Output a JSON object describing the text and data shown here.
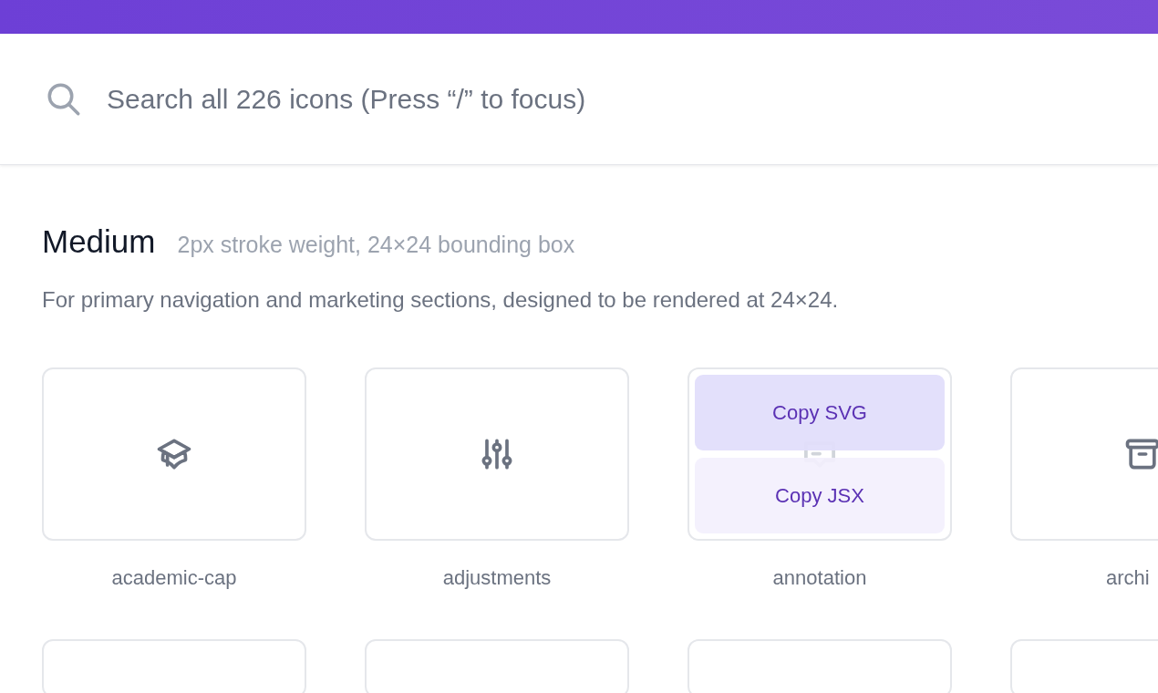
{
  "search": {
    "placeholder": "Search all 226 icons (Press “/” to focus)"
  },
  "section": {
    "title": "Medium",
    "subtitle": "2px stroke weight, 24×24 bounding box",
    "description": "For primary navigation and marketing sections, designed to be rendered at 24×24."
  },
  "icons": [
    {
      "kind": "academic-cap",
      "label": "academic-cap",
      "hovered": false
    },
    {
      "kind": "adjustments",
      "label": "adjustments",
      "hovered": false
    },
    {
      "kind": "annotation",
      "label": "annotation",
      "hovered": true,
      "actions": [
        {
          "label": "Copy SVG",
          "selected": true
        },
        {
          "label": "Copy JSX",
          "selected": false
        }
      ]
    },
    {
      "kind": "archive",
      "label": "archi",
      "hovered": false
    }
  ]
}
